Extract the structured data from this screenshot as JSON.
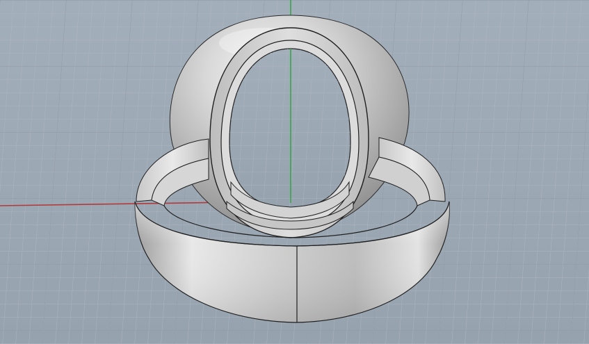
{
  "viewport": {
    "view": "Perspective",
    "background_color": "#9aa6b3",
    "grid": {
      "visible": true,
      "minor_line_color": "#aab4bf",
      "major_line_color": "#7f8a96"
    },
    "axes": {
      "x_axis_color": "#b33a3a",
      "y_axis_color": "#3aa34a"
    }
  },
  "scene": {
    "objects": [
      {
        "name": "outer-ring",
        "type": "ring",
        "display": "shaded",
        "edge_color": "#000000"
      },
      {
        "name": "inner-ring",
        "type": "ring",
        "display": "shaded",
        "edge_color": "#000000"
      }
    ]
  }
}
